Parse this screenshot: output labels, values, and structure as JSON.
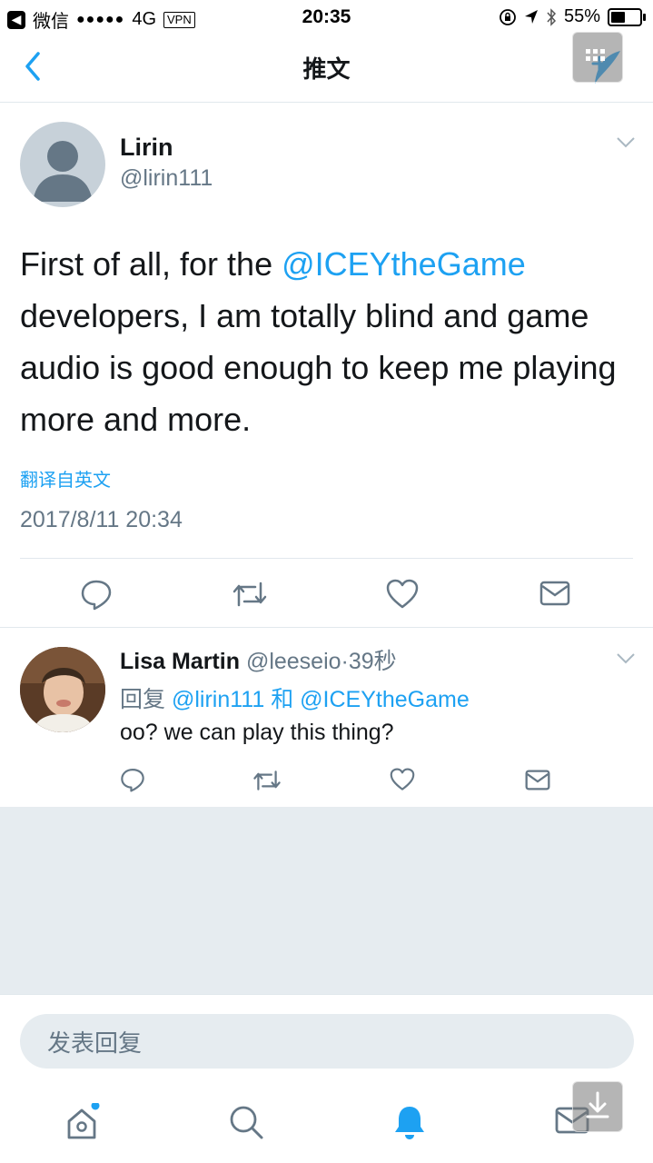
{
  "status_bar": {
    "app": "微信",
    "signal": "●●●●●",
    "network": "4G",
    "vpn": "VPN",
    "time": "20:35",
    "battery": "55%",
    "battery_level": 0.55
  },
  "nav": {
    "title": "推文"
  },
  "tweet": {
    "name": "Lirin",
    "handle": "@lirin111",
    "text_before": "First of all, for the ",
    "mention": "@ICEYtheGame",
    "text_after": " developers, I am totally blind and game audio is good enough to keep me playing more and more.",
    "translate": "翻译自英文",
    "timestamp": "2017/8/11 20:34"
  },
  "reply": {
    "name": "Lisa Martin",
    "handle": "@leeseio",
    "time": "39秒",
    "reply_label": "回复",
    "reply_user1": "@lirin111",
    "reply_and": "和",
    "reply_user2": "@ICEYtheGame",
    "text": "oo? we can play this thing?"
  },
  "compose": {
    "placeholder": "发表回复"
  },
  "icons": {
    "actions": [
      "reply-icon",
      "retweet-icon",
      "like-icon",
      "dm-icon"
    ],
    "tabs": [
      "home-icon",
      "search-icon",
      "notifications-icon",
      "messages-icon"
    ]
  },
  "colors": {
    "accent": "#1da1f2",
    "secondary_text": "#657786",
    "divider": "#e1e8ed",
    "background_gray": "#e6ecf0"
  }
}
